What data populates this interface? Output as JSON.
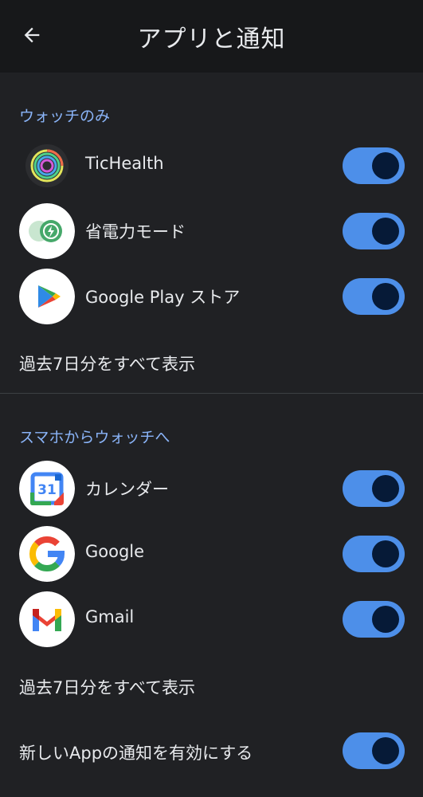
{
  "header": {
    "title": "アプリと通知",
    "back_icon": "arrow-back-icon"
  },
  "colors": {
    "background": "#202124",
    "header_background": "#17181a",
    "section_title": "#8ab4f8",
    "toggle_track": "#4d8fe9",
    "toggle_knob": "#061a37",
    "text": "#e8eaed"
  },
  "watch_only": {
    "section_title": "ウォッチのみ",
    "apps": [
      {
        "label": "TicHealth",
        "icon": "tichealth-icon",
        "enabled": true
      },
      {
        "label": "省電力モード",
        "icon": "battery-saver-icon",
        "enabled": true
      },
      {
        "label": "Google Play ストア",
        "icon": "google-play-icon",
        "enabled": true
      }
    ],
    "show_all_label": "過去7日分をすべて表示"
  },
  "phone_to_watch": {
    "section_title": "スマホからウォッチへ",
    "apps": [
      {
        "label": "カレンダー",
        "icon": "google-calendar-icon",
        "icon_text": "31",
        "enabled": true
      },
      {
        "label": "Google",
        "icon": "google-g-icon",
        "enabled": true
      },
      {
        "label": "Gmail",
        "icon": "gmail-icon",
        "enabled": true
      }
    ],
    "show_all_label": "過去7日分をすべて表示"
  },
  "new_app_notifications": {
    "label": "新しいAppの通知を有効にする",
    "enabled": true
  }
}
